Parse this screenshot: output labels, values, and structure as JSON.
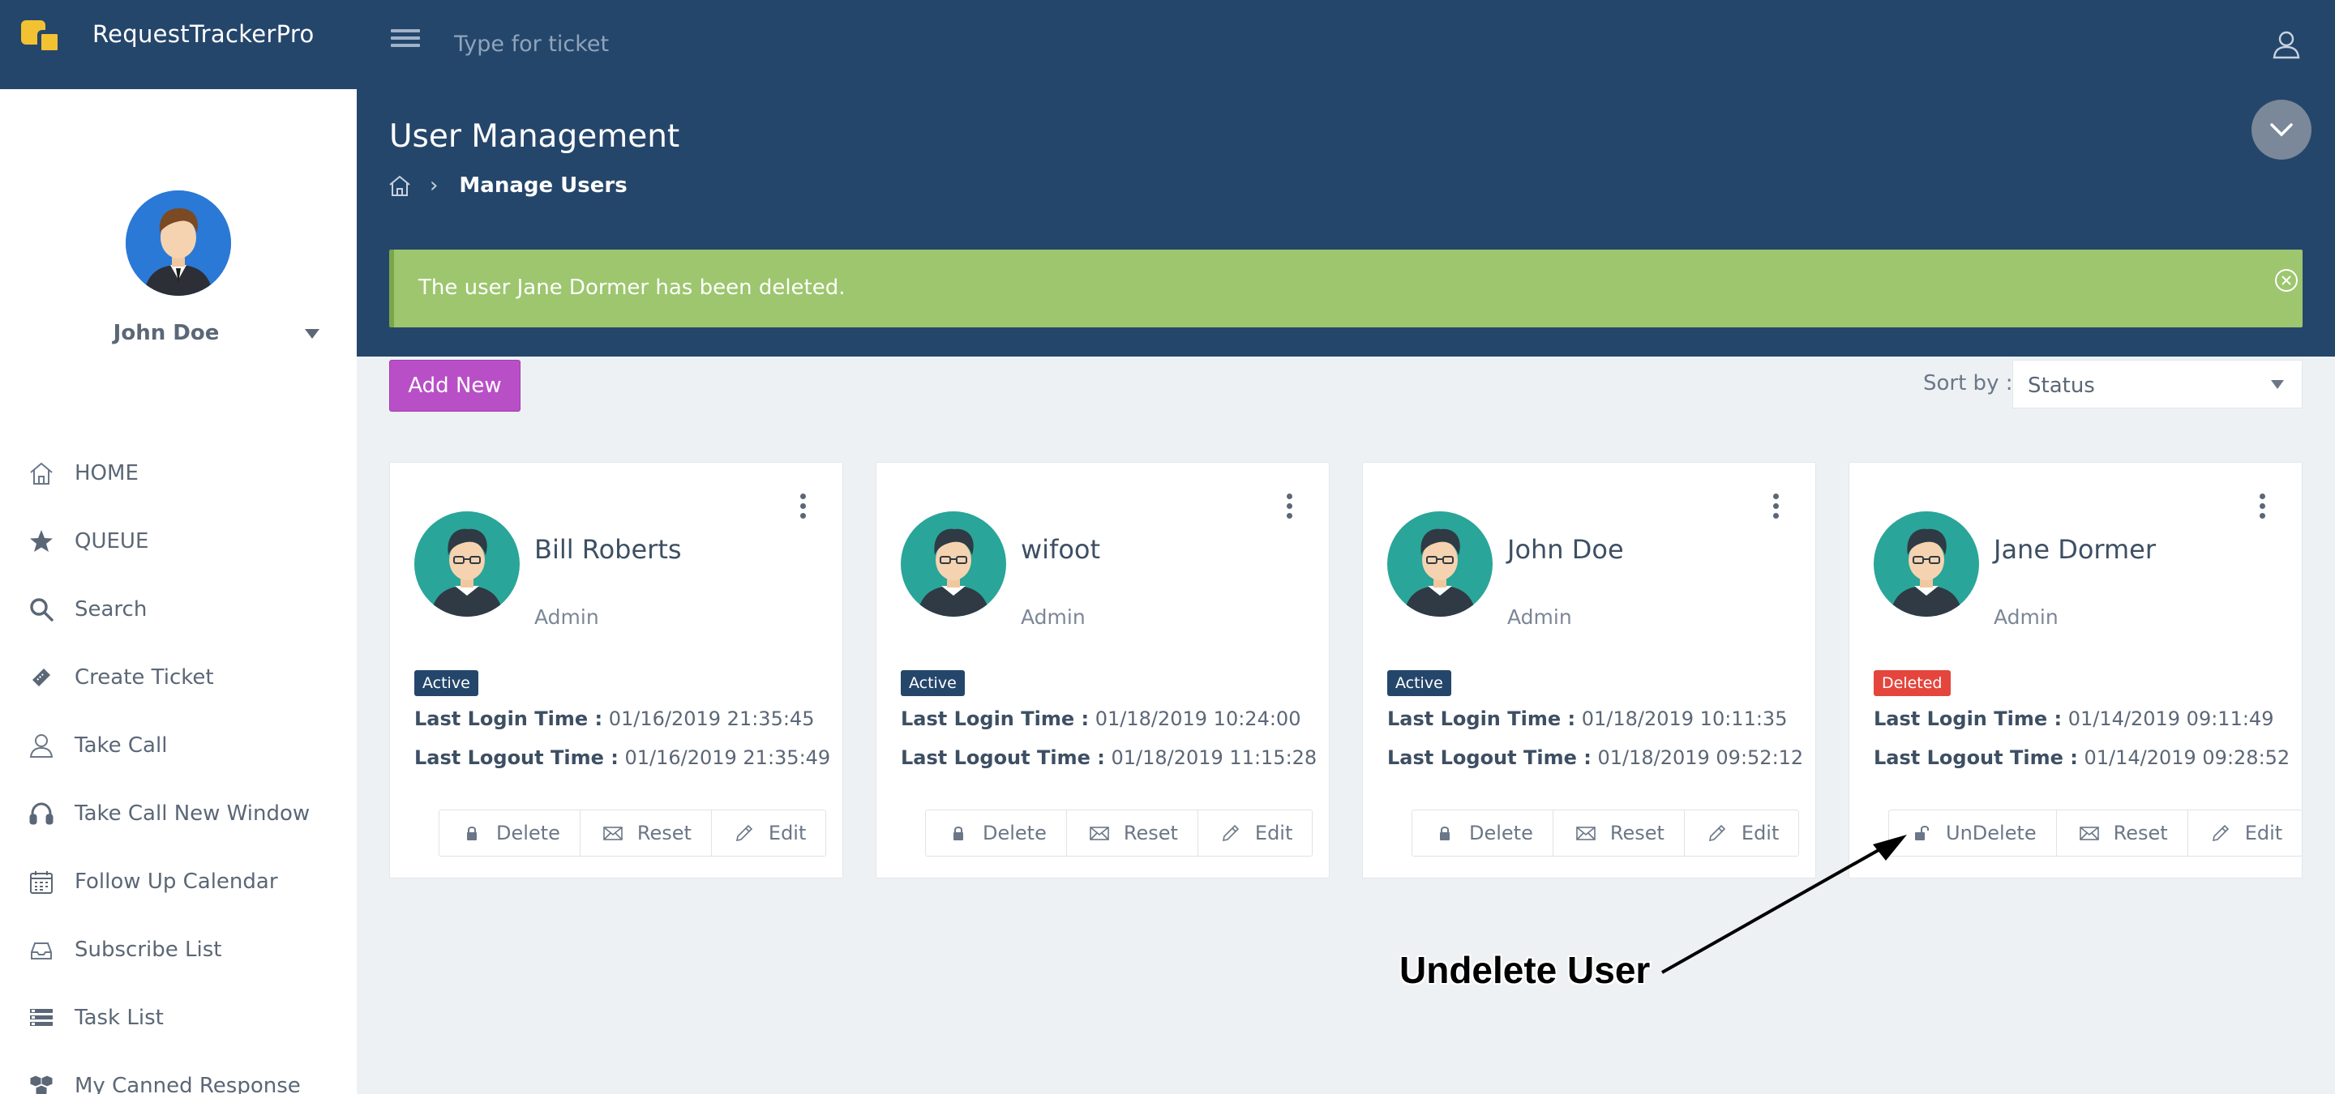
{
  "app": {
    "title": "RequestTrackerPro"
  },
  "header": {
    "search_placeholder": "Type for ticket"
  },
  "profile": {
    "name": "John Doe"
  },
  "sidebar": {
    "items": [
      {
        "label": "HOME",
        "icon": "home-icon"
      },
      {
        "label": "QUEUE",
        "icon": "star-icon"
      },
      {
        "label": "Search",
        "icon": "search-icon"
      },
      {
        "label": "Create Ticket",
        "icon": "ticket-icon"
      },
      {
        "label": "Take Call",
        "icon": "user-icon"
      },
      {
        "label": "Take Call New Window",
        "icon": "headset-icon"
      },
      {
        "label": "Follow Up Calendar",
        "icon": "calendar-icon"
      },
      {
        "label": "Subscribe List",
        "icon": "inbox-icon"
      },
      {
        "label": "Task List",
        "icon": "list-icon"
      },
      {
        "label": "My Canned Response",
        "icon": "cubes-icon"
      }
    ]
  },
  "page": {
    "title": "User Management",
    "breadcrumb": "Manage Users"
  },
  "alert": {
    "message": "The user Jane Dormer has been deleted."
  },
  "toolbar": {
    "add_label": "Add New",
    "sort_label": "Sort by :",
    "sort_value": "Status"
  },
  "labels": {
    "last_login": "Last Login Time :",
    "last_logout": "Last Logout Time :"
  },
  "users": [
    {
      "name": "Bill Roberts",
      "role": "Admin",
      "status": "Active",
      "last_login": "01/16/2019 21:35:45",
      "last_logout": "01/16/2019 21:35:49",
      "actions": [
        "Delete",
        "Reset",
        "Edit"
      ]
    },
    {
      "name": "wifoot",
      "role": "Admin",
      "status": "Active",
      "last_login": "01/18/2019 10:24:00",
      "last_logout": "01/18/2019 11:15:28",
      "actions": [
        "Delete",
        "Reset",
        "Edit"
      ]
    },
    {
      "name": "John Doe",
      "role": "Admin",
      "status": "Active",
      "last_login": "01/18/2019 10:11:35",
      "last_logout": "01/18/2019 09:52:12",
      "actions": [
        "Delete",
        "Reset",
        "Edit"
      ]
    },
    {
      "name": "Jane Dormer",
      "role": "Admin",
      "status": "Deleted",
      "last_login": "01/14/2019 09:11:49",
      "last_logout": "01/14/2019 09:28:52",
      "actions": [
        "UnDelete",
        "Reset",
        "Edit"
      ]
    }
  ],
  "annotation": {
    "text": "Undelete User"
  },
  "colors": {
    "header": "#25466b",
    "alert": "#9dc66e",
    "add_button": "#b94fc7",
    "active_badge": "#25466b",
    "deleted_badge": "#e4463d",
    "avatar": "#2aa599"
  }
}
